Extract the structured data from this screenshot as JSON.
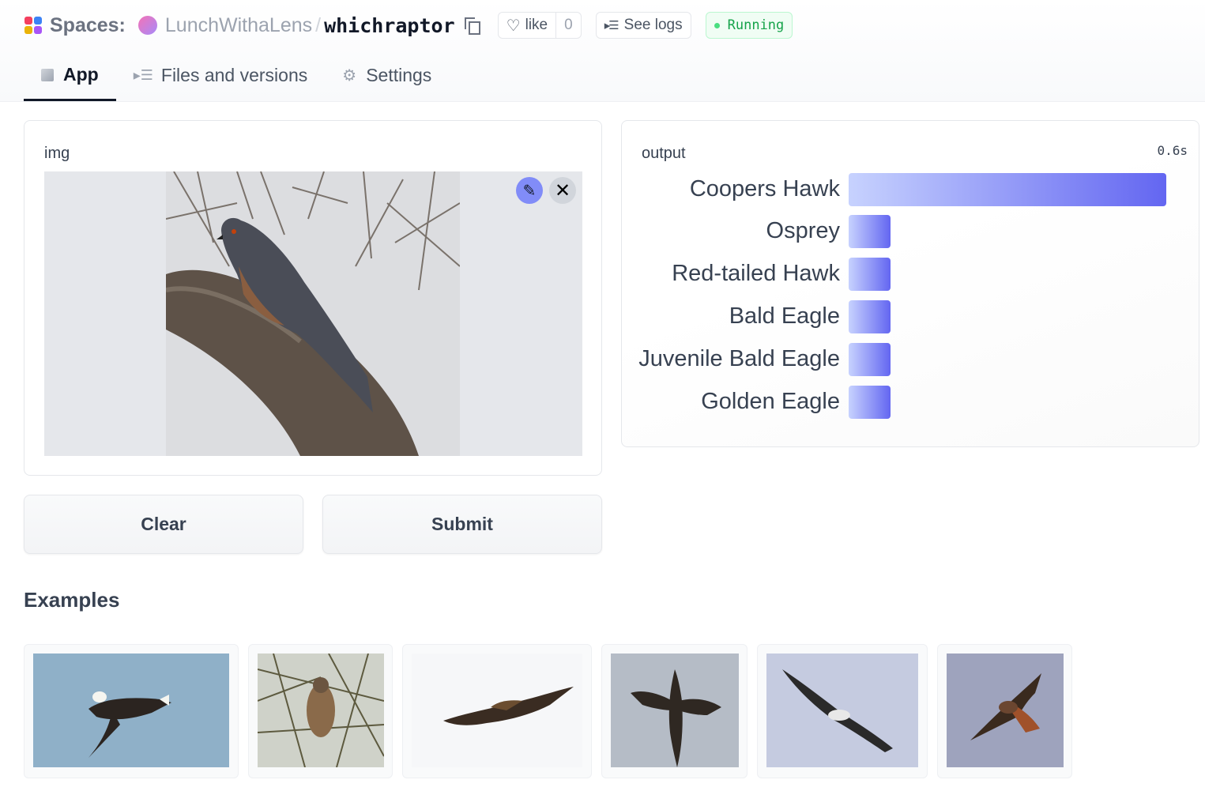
{
  "header": {
    "spaces_label": "Spaces:",
    "owner": "LunchWithaLens",
    "separator": "/",
    "repo": "whichraptor",
    "like_label": "like",
    "like_count": "0",
    "logs_label": "See logs",
    "status": "Running"
  },
  "tabs": [
    {
      "label": "App",
      "icon": "cube-icon"
    },
    {
      "label": "Files and versions",
      "icon": "files-icon"
    },
    {
      "label": "Settings",
      "icon": "gear-icon"
    }
  ],
  "input": {
    "label": "img",
    "image_desc_icon": "photo"
  },
  "output": {
    "label": "output",
    "timing": "0.6s",
    "labels": [
      {
        "name": "Coopers Hawk",
        "confidence": 0.88
      },
      {
        "name": "Osprey",
        "confidence": 0.03
      },
      {
        "name": "Red-tailed Hawk",
        "confidence": 0.03
      },
      {
        "name": "Bald Eagle",
        "confidence": 0.02
      },
      {
        "name": "Juvenile Bald Eagle",
        "confidence": 0.02
      },
      {
        "name": "Golden Eagle",
        "confidence": 0.02
      }
    ]
  },
  "buttons": {
    "clear": "Clear",
    "submit": "Submit"
  },
  "examples": {
    "title": "Examples"
  },
  "colors": {
    "accent": "#6366f1",
    "running": "#16a34a"
  }
}
